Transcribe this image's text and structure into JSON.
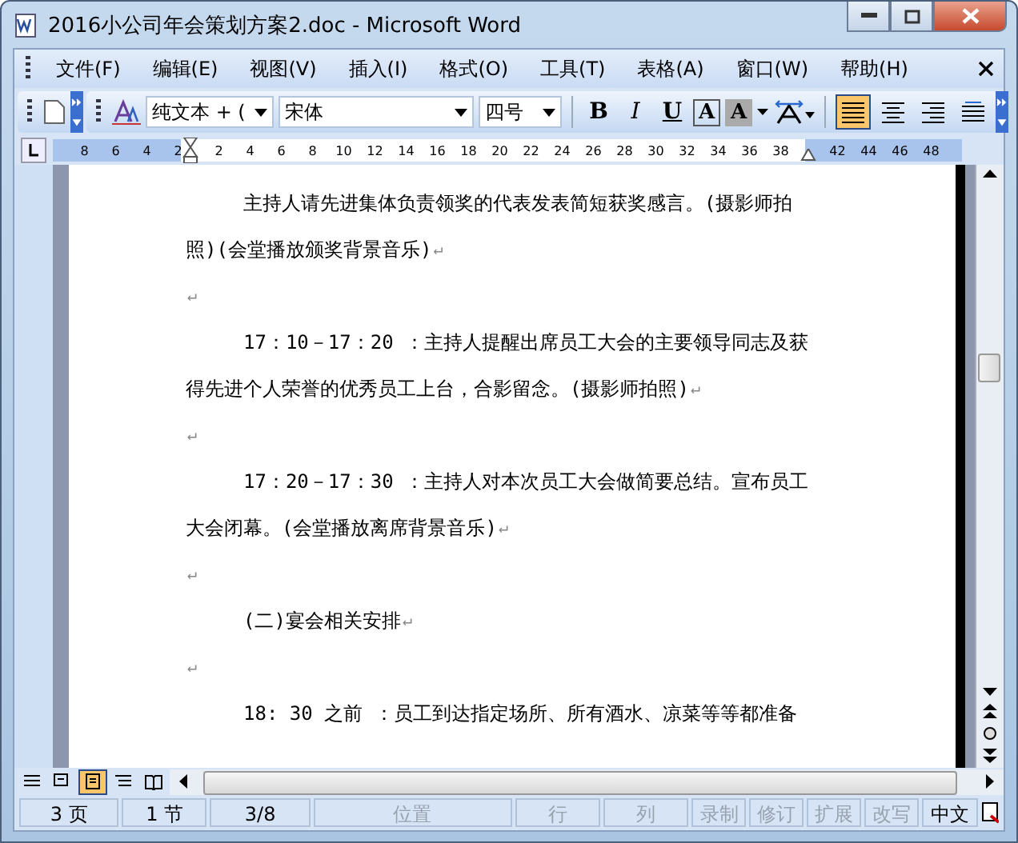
{
  "window": {
    "title": "2016小公司年会策划方案2.doc - Microsoft Word"
  },
  "menu": [
    "文件(F)",
    "编辑(E)",
    "视图(V)",
    "插入(I)",
    "格式(O)",
    "工具(T)",
    "表格(A)",
    "窗口(W)",
    "帮助(H)"
  ],
  "toolbar": {
    "style": "纯文本 + (",
    "font": "宋体",
    "size": "四号",
    "format_buttons": [
      "B",
      "I",
      "U",
      "A",
      "A"
    ],
    "align_buttons": [
      {
        "selected": true
      },
      {
        "selected": false
      },
      {
        "selected": false
      },
      {
        "selected": false
      }
    ]
  },
  "ruler": [
    "8",
    "6",
    "4",
    "2",
    "2",
    "4",
    "6",
    "8",
    "10",
    "12",
    "14",
    "16",
    "18",
    "20",
    "22",
    "24",
    "26",
    "28",
    "30",
    "32",
    "34",
    "36",
    "38",
    "42",
    "44",
    "46",
    "48"
  ],
  "document": {
    "lines": [
      {
        "text": "主持人请先进集体负责领奖的代表发表简短获奖感言。(摄影师拍",
        "indent": true
      },
      {
        "text": "照)(会堂播放颁奖背景音乐)",
        "indent": false,
        "mark": "↵"
      },
      {
        "indent": false,
        "mark": "↵"
      },
      {
        "text": "17：10－17：20 ：主持人提醒出席员工大会的主要领导同志及获",
        "indent": true
      },
      {
        "text": "得先进个人荣誉的优秀员工上台，合影留念。(摄影师拍照)",
        "indent": false,
        "mark": "↵"
      },
      {
        "indent": false,
        "mark": "↵"
      },
      {
        "text": "17：20－17：30 ：主持人对本次员工大会做简要总结。宣布员工",
        "indent": true
      },
      {
        "text": "大会闭幕。(会堂播放离席背景音乐)",
        "indent": false,
        "mark": "↵"
      },
      {
        "indent": false,
        "mark": "↵"
      },
      {
        "text": "(二)宴会相关安排",
        "indent": true,
        "mark": "↵"
      },
      {
        "indent": false,
        "mark": "↵"
      },
      {
        "text": "18: 30 之前 ：员工到达指定场所、所有酒水、凉菜等等都准备",
        "indent": true
      }
    ]
  },
  "view_buttons": [
    {
      "selected": false
    },
    {
      "selected": false
    },
    {
      "selected": true
    },
    {
      "selected": false
    },
    {
      "selected": false
    }
  ],
  "status_bar": [
    {
      "text": "3 页",
      "disabled": false
    },
    {
      "text": "1 节",
      "disabled": false
    },
    {
      "text": "3/8",
      "disabled": false
    },
    {
      "text": "位置",
      "disabled": true
    },
    {
      "text": "行",
      "disabled": true
    },
    {
      "text": "列",
      "disabled": true
    },
    {
      "text": "录制",
      "disabled": true
    },
    {
      "text": "修订",
      "disabled": true
    },
    {
      "text": "扩展",
      "disabled": true
    },
    {
      "text": "改写",
      "disabled": true
    },
    {
      "text": "中文",
      "disabled": false
    }
  ]
}
